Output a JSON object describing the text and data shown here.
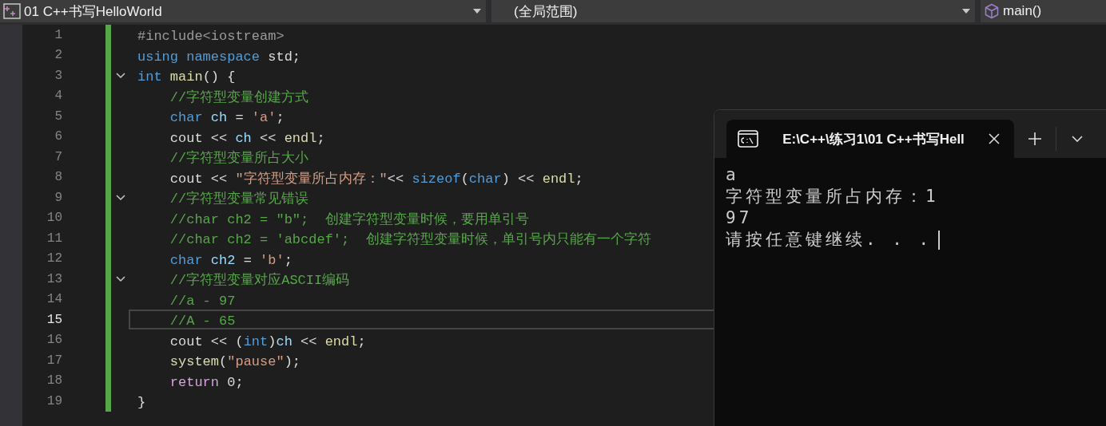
{
  "navigation_bar": {
    "project": "01 C++书写HelloWorld",
    "scope": "(全局范围)",
    "member": "main()"
  },
  "editor": {
    "lines": [
      {
        "number": "1",
        "modified": true,
        "fold_toggle": false,
        "selected": false,
        "tokens": [
          {
            "kind": "preproc",
            "text": "#include<iostream>"
          }
        ]
      },
      {
        "number": "2",
        "modified": true,
        "fold_toggle": false,
        "selected": false,
        "tokens": [
          {
            "kind": "keyword",
            "text": "using namespace"
          },
          {
            "kind": "plain",
            "text": " std;"
          }
        ]
      },
      {
        "number": "3",
        "modified": true,
        "fold_toggle": true,
        "selected": false,
        "tokens": [
          {
            "kind": "keyword",
            "text": "int"
          },
          {
            "kind": "function",
            "text": " main"
          },
          {
            "kind": "plain",
            "text": "() {"
          }
        ]
      },
      {
        "number": "4",
        "modified": true,
        "fold_toggle": false,
        "selected": false,
        "tokens": [
          {
            "kind": "comment",
            "text": "    //字符型变量创建方式"
          }
        ]
      },
      {
        "number": "5",
        "modified": true,
        "fold_toggle": false,
        "selected": false,
        "tokens": [
          {
            "kind": "keyword",
            "text": "    char"
          },
          {
            "kind": "variable",
            "text": " ch"
          },
          {
            "kind": "plain",
            "text": " = "
          },
          {
            "kind": "string",
            "text": "'a'"
          },
          {
            "kind": "plain",
            "text": ";"
          }
        ]
      },
      {
        "number": "6",
        "modified": true,
        "fold_toggle": false,
        "selected": false,
        "tokens": [
          {
            "kind": "plain",
            "text": "    cout << "
          },
          {
            "kind": "variable",
            "text": "ch"
          },
          {
            "kind": "plain",
            "text": " << "
          },
          {
            "kind": "function",
            "text": "endl"
          },
          {
            "kind": "plain",
            "text": ";"
          }
        ]
      },
      {
        "number": "7",
        "modified": true,
        "fold_toggle": false,
        "selected": false,
        "tokens": [
          {
            "kind": "comment",
            "text": "    //字符型变量所占大小"
          }
        ]
      },
      {
        "number": "8",
        "modified": true,
        "fold_toggle": false,
        "selected": false,
        "tokens": [
          {
            "kind": "plain",
            "text": "    cout << "
          },
          {
            "kind": "string",
            "text": "\"字符型变量所占内存：\""
          },
          {
            "kind": "plain",
            "text": "<< "
          },
          {
            "kind": "keyword",
            "text": "sizeof"
          },
          {
            "kind": "plain",
            "text": "("
          },
          {
            "kind": "keyword",
            "text": "char"
          },
          {
            "kind": "plain",
            "text": ") << "
          },
          {
            "kind": "function",
            "text": "endl"
          },
          {
            "kind": "plain",
            "text": ";"
          }
        ]
      },
      {
        "number": "9",
        "modified": true,
        "fold_toggle": true,
        "selected": false,
        "tokens": [
          {
            "kind": "comment",
            "text": "    //字符型变量常见错误"
          }
        ]
      },
      {
        "number": "10",
        "modified": true,
        "fold_toggle": false,
        "selected": false,
        "tokens": [
          {
            "kind": "comment",
            "text": "    //char ch2 = \"b\";  创建字符型变量时候，要用单引号"
          }
        ]
      },
      {
        "number": "11",
        "modified": true,
        "fold_toggle": false,
        "selected": false,
        "tokens": [
          {
            "kind": "comment",
            "text": "    //char ch2 = 'abcdef';  创建字符型变量时候，单引号内只能有一个字符"
          }
        ]
      },
      {
        "number": "12",
        "modified": true,
        "fold_toggle": false,
        "selected": false,
        "tokens": [
          {
            "kind": "keyword",
            "text": "    char"
          },
          {
            "kind": "variable",
            "text": " ch2"
          },
          {
            "kind": "plain",
            "text": " = "
          },
          {
            "kind": "string",
            "text": "'b'"
          },
          {
            "kind": "plain",
            "text": ";"
          }
        ]
      },
      {
        "number": "13",
        "modified": true,
        "fold_toggle": true,
        "selected": false,
        "tokens": [
          {
            "kind": "comment",
            "text": "    //字符型变量对应ASCII编码"
          }
        ]
      },
      {
        "number": "14",
        "modified": true,
        "fold_toggle": false,
        "selected": false,
        "tokens": [
          {
            "kind": "comment",
            "text": "    //a - 97"
          }
        ]
      },
      {
        "number": "15",
        "modified": true,
        "fold_toggle": false,
        "selected": true,
        "tokens": [
          {
            "kind": "comment",
            "text": "    //A - 65"
          }
        ]
      },
      {
        "number": "16",
        "modified": true,
        "fold_toggle": false,
        "selected": false,
        "tokens": [
          {
            "kind": "plain",
            "text": "    cout << ("
          },
          {
            "kind": "keyword",
            "text": "int"
          },
          {
            "kind": "plain",
            "text": ")"
          },
          {
            "kind": "variable",
            "text": "ch"
          },
          {
            "kind": "plain",
            "text": " << "
          },
          {
            "kind": "function",
            "text": "endl"
          },
          {
            "kind": "plain",
            "text": ";"
          }
        ]
      },
      {
        "number": "17",
        "modified": true,
        "fold_toggle": false,
        "selected": false,
        "tokens": [
          {
            "kind": "function",
            "text": "    system"
          },
          {
            "kind": "plain",
            "text": "("
          },
          {
            "kind": "string",
            "text": "\"pause\""
          },
          {
            "kind": "plain",
            "text": ");"
          }
        ]
      },
      {
        "number": "18",
        "modified": true,
        "fold_toggle": false,
        "selected": false,
        "tokens": [
          {
            "kind": "control",
            "text": "    return"
          },
          {
            "kind": "plain",
            "text": " 0;"
          }
        ]
      },
      {
        "number": "19",
        "modified": true,
        "fold_toggle": false,
        "selected": false,
        "tokens": [
          {
            "kind": "plain",
            "text": "}"
          }
        ]
      }
    ]
  },
  "terminal": {
    "tab_title": "E:\\C++\\练习1\\01 C++书写Hell",
    "output": [
      "a",
      "字符型变量所占内存：1",
      "97",
      "请按任意键继续. . ."
    ]
  }
}
